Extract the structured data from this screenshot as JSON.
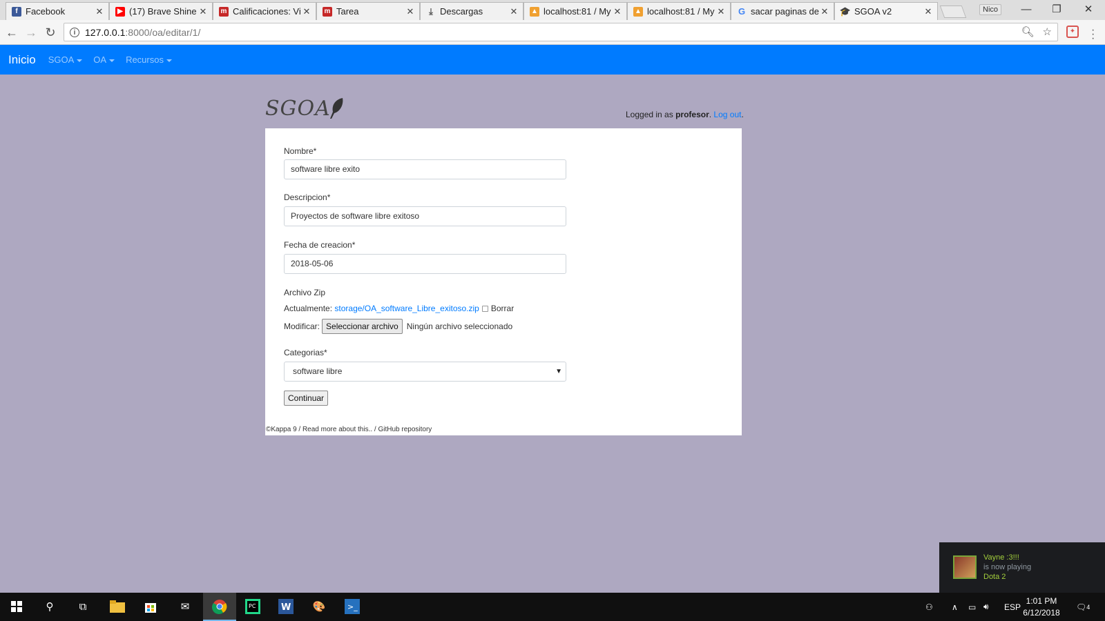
{
  "browser": {
    "tabs": [
      {
        "title": "Facebook",
        "icon": "facebook-icon",
        "color": "#3b5998"
      },
      {
        "title": "(17) Brave Shine",
        "icon": "youtube-icon",
        "color": "#ff0000"
      },
      {
        "title": "Calificaciones: Vi",
        "icon": "moodle-icon",
        "color": "#c62828"
      },
      {
        "title": "Tarea",
        "icon": "moodle-icon",
        "color": "#c62828"
      },
      {
        "title": "Descargas",
        "icon": "download-icon",
        "color": "#555555"
      },
      {
        "title": "localhost:81 / My",
        "icon": "phpmyadmin-icon",
        "color": "#f0a030"
      },
      {
        "title": "localhost:81 / My",
        "icon": "phpmyadmin-icon",
        "color": "#f0a030"
      },
      {
        "title": "sacar paginas de",
        "icon": "google-icon",
        "color": "#4285f4"
      },
      {
        "title": "SGOA v2",
        "icon": "graduation-cap-icon",
        "color": "#222222"
      }
    ],
    "user": "Nico",
    "url_host": "127.0.0.1",
    "url_rest": ":8000/oa/editar/1/"
  },
  "navbar": {
    "brand": "Inicio",
    "links": [
      "SGOA",
      "OA",
      "Recursos"
    ]
  },
  "header": {
    "logo": "SGOA",
    "logged_prefix": "Logged in as ",
    "user": "profesor",
    "logged_mid": ". ",
    "logout": "Log out",
    "logged_suffix": "."
  },
  "form": {
    "nombre_label": "Nombre*",
    "nombre_value": "software libre exito",
    "descripcion_label": "Descripcion*",
    "descripcion_value": "Proyectos de software libre exitoso",
    "fecha_label": "Fecha de creacion*",
    "fecha_value": "2018-05-06",
    "zip_label": "Archivo Zip",
    "actualmente": "Actualmente:",
    "zip_link": "storage/OA_software_Libre_exitoso.zip",
    "borrar": "Borrar",
    "modificar": "Modificar:",
    "file_button": "Seleccionar archivo",
    "no_file": "Ningún archivo seleccionado",
    "categorias_label": "Categorias*",
    "categorias_value": "software libre",
    "submit": "Continuar"
  },
  "footer": {
    "text": "©Kappa 9 / Read more about this.. / GitHub repository"
  },
  "notification": {
    "name": "Vayne :3!!!",
    "status": "is now playing",
    "game": "Dota 2"
  },
  "taskbar": {
    "lang": "ESP",
    "time": "1:01 PM",
    "date": "6/12/2018",
    "notif_count": "4"
  }
}
